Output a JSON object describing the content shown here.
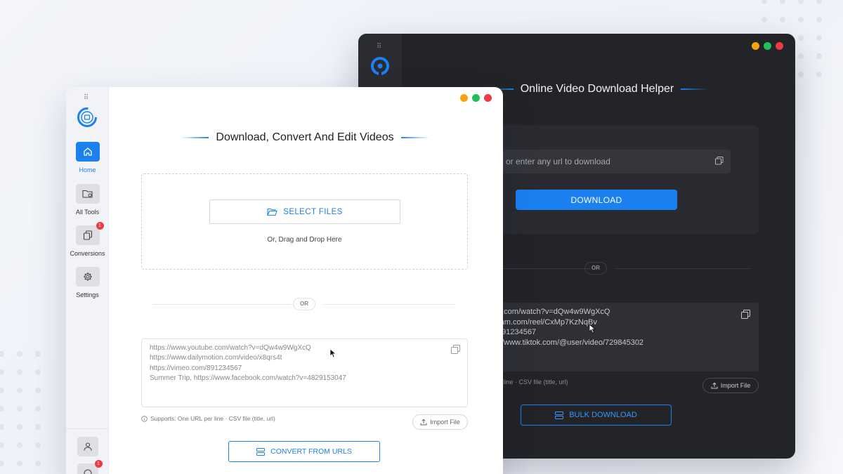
{
  "dark_window": {
    "title": "Online Video Download Helper",
    "url_placeholder": "or enter any url to download",
    "download_label": "DOWNLOAD",
    "or_label": "OR",
    "urls": [
      "e.com/watch?v=dQw4w9WgXcQ",
      "ram.com/reel/CxMp7KzNqBv",
      "891234567",
      "://www.tiktok.com/@user/video/729845302"
    ],
    "supports_text": "er line · CSV file (title, url)",
    "import_label": "Import File",
    "bulk_label": "BULK DOWNLOAD"
  },
  "light_window": {
    "title": "Download, Convert And Edit Videos",
    "select_label": "SELECT FILES",
    "drag_text": "Or, Drag and Drop Here",
    "or_label": "OR",
    "urls": [
      "https://www.youtube.com/watch?v=dQw4w9WgXcQ",
      "https://www.dailymotion.com/video/x8qrs4t",
      "https://vimeo.com/891234567",
      "Summer Trip, https://www.facebook.com/watch?v=4829153047"
    ],
    "supports_text": "Supports: One URL per line · CSV file (title, url)",
    "import_label": "Import File",
    "convert_label": "CONVERT FROM URLS"
  },
  "sidebar": {
    "items": [
      {
        "label": "Home",
        "active": true
      },
      {
        "label": "All Tools"
      },
      {
        "label": "Conversions",
        "badge": "1"
      },
      {
        "label": "Settings"
      }
    ],
    "bottom_badge": "1"
  },
  "colors": {
    "accent": "#1b81f0",
    "traffic_orange": "#f6a213",
    "traffic_green": "#1fbf5c",
    "traffic_red": "#ef3a43",
    "dark_bg": "#232428"
  }
}
